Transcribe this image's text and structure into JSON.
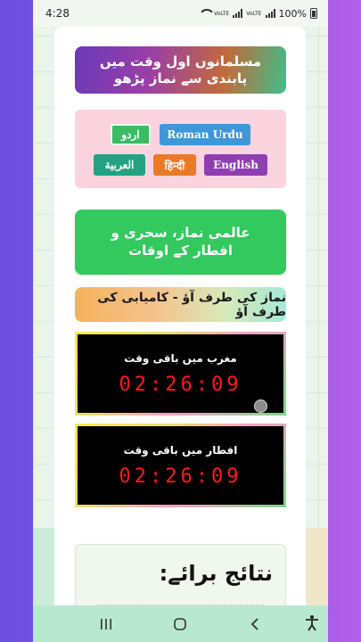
{
  "status_bar": {
    "time": "4:28",
    "battery": "100%",
    "network_1": "VoLTE",
    "network_2": "VoLTE"
  },
  "banner": {
    "text": "مسلمانوں اول وقت میں پابندی سے نماز پڑھو"
  },
  "languages": {
    "urdu": "اردو",
    "roman_urdu": "Roman Urdu",
    "arabic": "العربية",
    "hindi": "हिन्दी",
    "english": "English"
  },
  "times_button": {
    "label": "عالمی نماز، سحری و افطار کے اوقات"
  },
  "slogan": {
    "text": "نماز کی طرف آؤ - کامیابی کی طرف آؤ"
  },
  "timers": [
    {
      "label": "مغرب میں باقی وقت",
      "value": "02:26:09"
    },
    {
      "label": "افطار میں باقی وقت",
      "value": "02:26:09"
    }
  ],
  "results": {
    "title": "نتائج برائے:"
  },
  "colors": {
    "green": "#33c95e",
    "timer_red": "#ff1a1a",
    "lang_bg": "#fbd3df"
  }
}
